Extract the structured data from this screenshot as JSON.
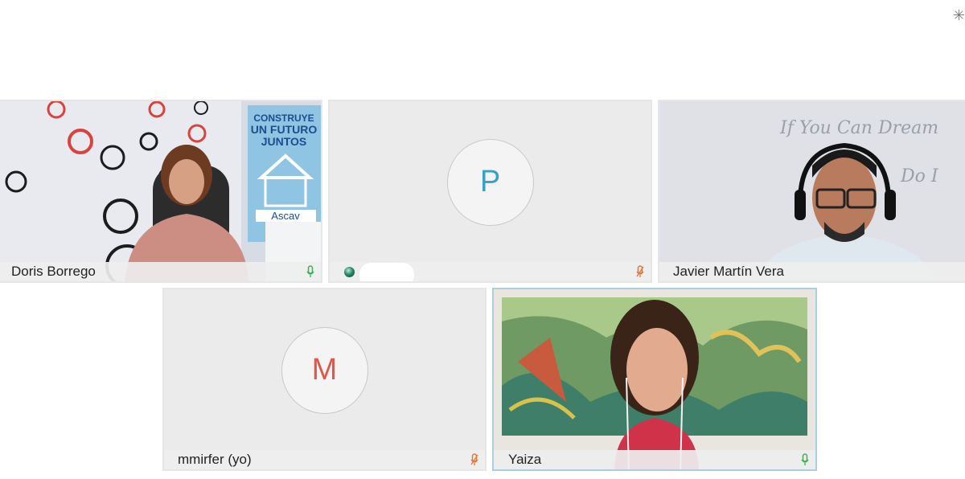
{
  "window": {
    "corner_icon": "✳"
  },
  "colors": {
    "avatar_p": "#3aa0c8",
    "avatar_m": "#e0584a",
    "mic_on": "#3fae55",
    "mic_off": "#e0783a",
    "active_border": "#a9cfe0"
  },
  "participants": [
    {
      "name": "Doris Borrego",
      "mic": "mic-on-icon",
      "kind": "video"
    },
    {
      "name": "",
      "avatar_letter": "P",
      "mic": "mic-off-icon",
      "kind": "avatar"
    },
    {
      "name": "Javier Martín Vera",
      "mic": "none",
      "kind": "video"
    },
    {
      "name": "mmirfer (yo)",
      "avatar_letter": "M",
      "mic": "mic-off-icon",
      "kind": "avatar"
    },
    {
      "name": "Yaiza",
      "mic": "mic-on-icon",
      "kind": "video",
      "active": true
    }
  ]
}
